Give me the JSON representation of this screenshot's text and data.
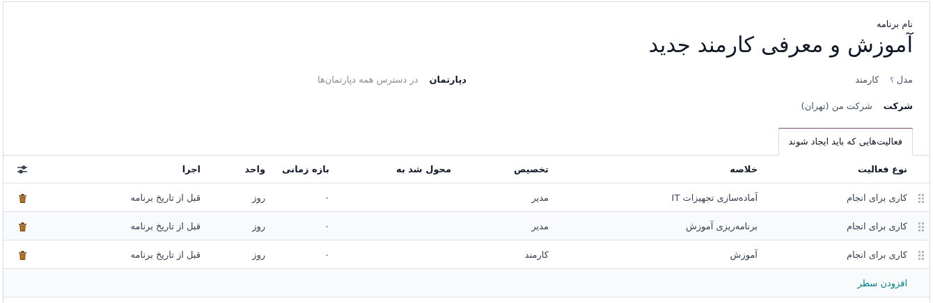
{
  "program": {
    "name_label": "نام برنامه",
    "name": "آموزش و معرفی کارمند جدید"
  },
  "fields": [
    {
      "label": "مدل",
      "help_mark": "؟",
      "value": "کارمند",
      "bold_label": false
    },
    {
      "label": "دپارتمان",
      "placeholder": "در دسترس همه دپارتمان‌ها",
      "bold_label": true
    },
    {
      "label": "شرکت",
      "value": "شرکت من (تهران)",
      "bold_label": true
    }
  ],
  "tabs": [
    {
      "label": "فعالیت‌هایی که باید ایجاد شوند",
      "selected": true
    }
  ],
  "table": {
    "columns": [
      "نوع فعالیت",
      "خلاصه",
      "تخصیص",
      "محول شد به",
      "بازه زمانی",
      "واحد",
      "اجرا"
    ],
    "rows": [
      [
        "کاری برای انجام",
        "آماده‌سازی تجهیزات IT",
        "مدیر",
        "",
        "۰",
        "روز",
        "قبل از تاریخ برنامه"
      ],
      [
        "کاری برای انجام",
        "برنامه‌ریزی آموزش",
        "مدیر",
        "",
        "۰",
        "روز",
        "قبل از تاریخ برنامه"
      ],
      [
        "کاری برای انجام",
        "آموزش",
        "کارمند",
        "",
        "۰",
        "روز",
        "قبل از تاریخ برنامه"
      ]
    ],
    "add_line": "افزودن سطر"
  }
}
